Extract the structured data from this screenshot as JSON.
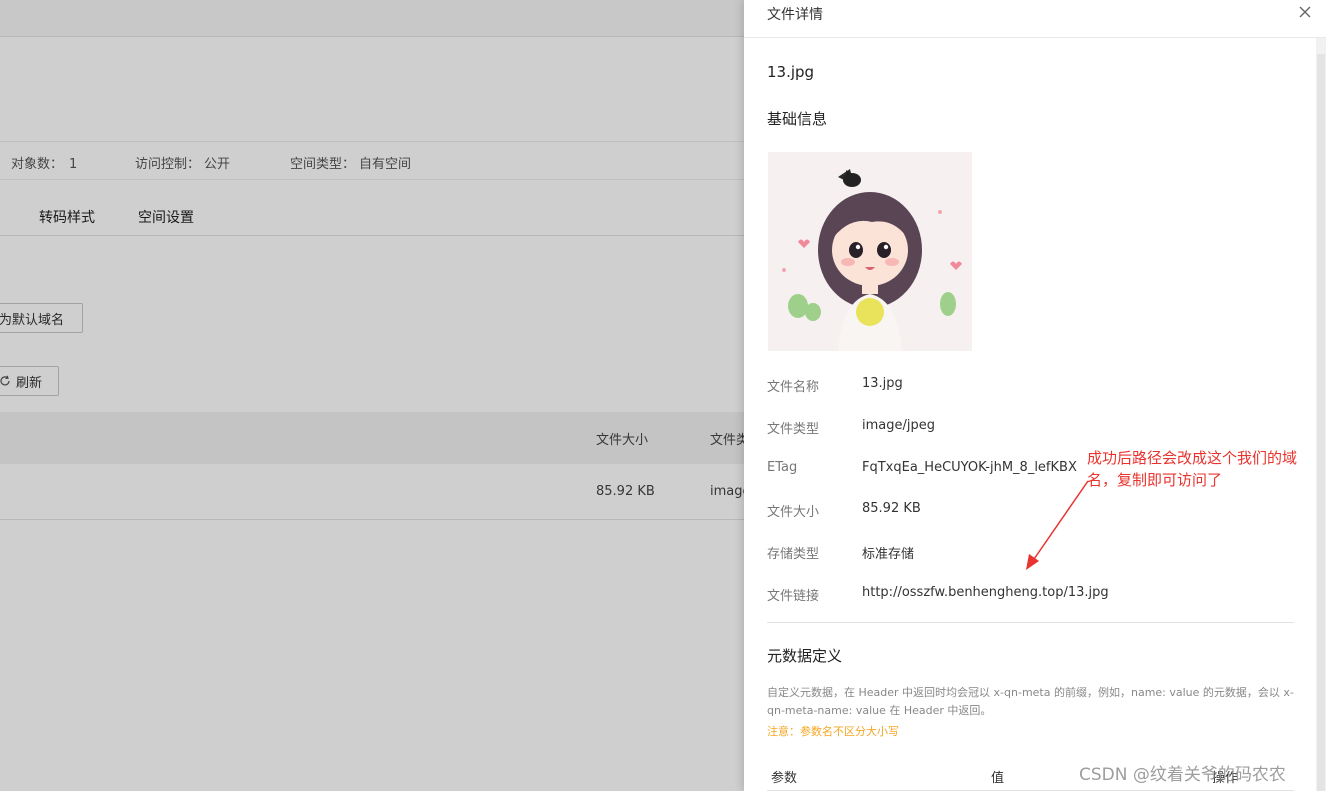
{
  "background": {
    "stats": [
      {
        "label": "对象数：",
        "value": "1"
      },
      {
        "label": "访问控制：",
        "value": "公开"
      },
      {
        "label": "空间类型：",
        "value": "自有空间"
      }
    ],
    "tabs": [
      "转码样式",
      "空间设置"
    ],
    "set_default_domain_label": "为默认域名",
    "refresh_label": "刷新",
    "table_headers": {
      "size": "文件大小",
      "type": "文件类"
    },
    "table_row": {
      "size": "85.92 KB",
      "type": "image"
    }
  },
  "drawer": {
    "title": "文件详情",
    "file_name": "13.jpg",
    "basic_info_title": "基础信息",
    "fields": [
      {
        "label": "文件名称",
        "value": "13.jpg"
      },
      {
        "label": "文件类型",
        "value": "image/jpeg"
      },
      {
        "label": "ETag",
        "value": "FqTxqEa_HeCUYOK-jhM_8_lefKBX"
      },
      {
        "label": "文件大小",
        "value": "85.92 KB"
      },
      {
        "label": "存储类型",
        "value": "标准存储"
      },
      {
        "label": "文件链接",
        "value": "http://osszfw.benhengheng.top/13.jpg"
      }
    ],
    "metadata_title": "元数据定义",
    "metadata_desc": "自定义元数据，在 Header 中返回时均会冠以 x-qn-meta 的前缀，例如，name: value 的元数据，会以 x-qn-meta-name: value 在 Header 中返回。",
    "metadata_note": "注意：参数名不区分大小写",
    "metadata_table": {
      "param": "参数",
      "value": "值",
      "action": "操作"
    }
  },
  "annotation": "成功后路径会改成这个我们的域名，复制即可访问了",
  "watermark": "CSDN @纹着关爷的码农农",
  "colors": {
    "annotation": "#e8332e",
    "note": "#f5a623"
  },
  "icons": {
    "close": "close-icon",
    "refresh": "refresh-icon"
  }
}
